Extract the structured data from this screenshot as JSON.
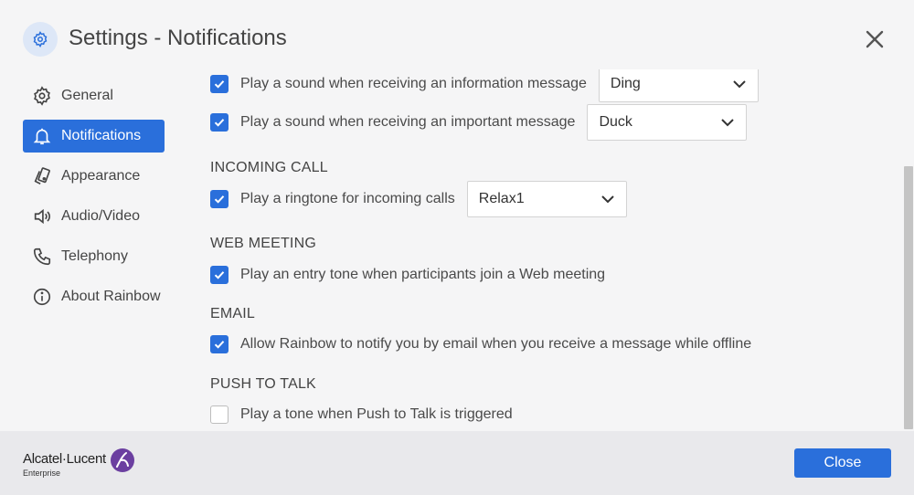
{
  "header": {
    "title": "Settings - Notifications"
  },
  "sidebar": {
    "items": [
      {
        "label": "General",
        "icon": "gear-icon",
        "active": false
      },
      {
        "label": "Notifications",
        "icon": "bell-icon",
        "active": true
      },
      {
        "label": "Appearance",
        "icon": "appearance-icon",
        "active": false
      },
      {
        "label": "Audio/Video",
        "icon": "speaker-icon",
        "active": false
      },
      {
        "label": "Telephony",
        "icon": "phone-icon",
        "active": false
      },
      {
        "label": "About Rainbow",
        "icon": "info-icon",
        "active": false
      }
    ]
  },
  "messages": {
    "info_label": "Play a sound when receiving an information message",
    "info_checked": true,
    "info_sound": "Ding",
    "important_label": "Play a sound when receiving an important message",
    "important_checked": true,
    "important_sound": "Duck"
  },
  "incoming_call": {
    "title": "INCOMING CALL",
    "label": "Play a ringtone for incoming calls",
    "checked": true,
    "ringtone": "Relax1"
  },
  "web_meeting": {
    "title": "WEB MEETING",
    "label": "Play an entry tone when participants join a Web meeting",
    "checked": true
  },
  "email": {
    "title": "EMAIL",
    "label": "Allow Rainbow to notify you by email when you receive a message while offline",
    "checked": true
  },
  "push_to_talk": {
    "title": "PUSH TO TALK",
    "label": "Play a tone when Push to Talk is triggered",
    "checked": false
  },
  "footer": {
    "brand": "Alcatel·Lucent",
    "brand_sub": "Enterprise",
    "close_label": "Close"
  },
  "colors": {
    "accent": "#2a6fdb",
    "brand_purple": "#6b3fa0"
  }
}
